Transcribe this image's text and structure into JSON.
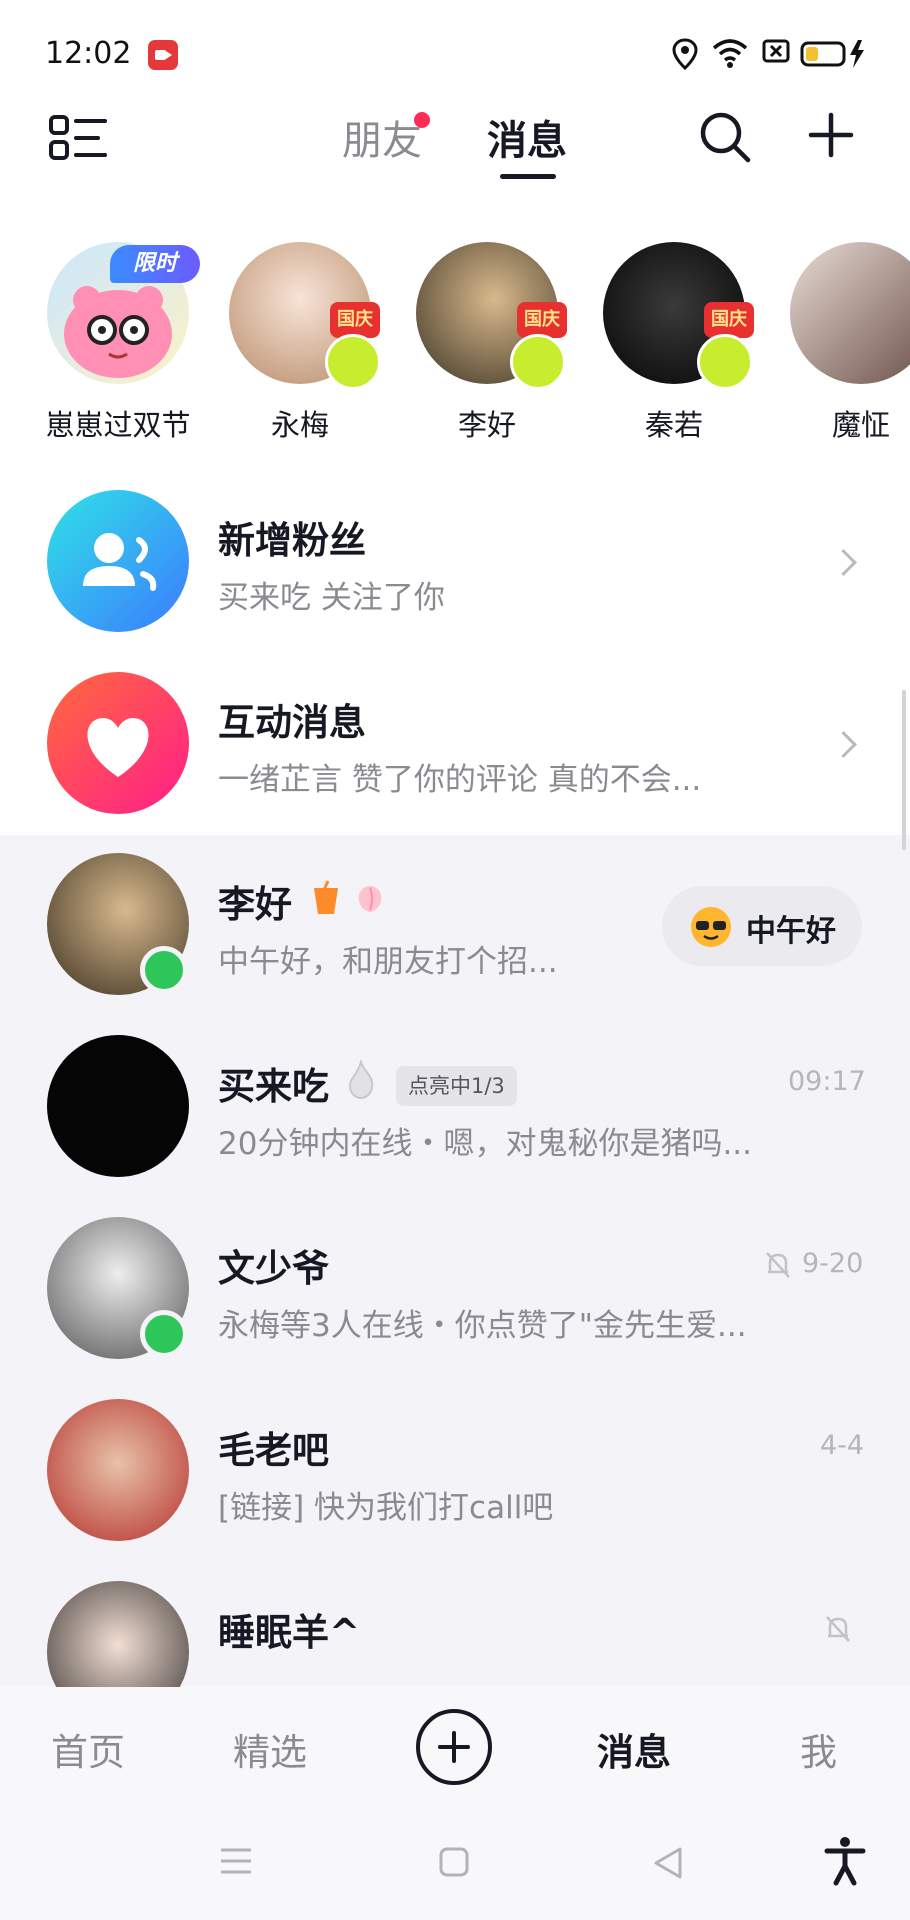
{
  "status_bar": {
    "time": "12:02"
  },
  "header": {
    "tabs": [
      {
        "label": "朋友"
      },
      {
        "label": "消息"
      }
    ]
  },
  "stories": [
    {
      "name": "崽崽过双节",
      "tag": "限时"
    },
    {
      "name": "永梅",
      "badge": "国庆"
    },
    {
      "name": "李好",
      "badge": "国庆"
    },
    {
      "name": "秦若",
      "badge": "国庆"
    },
    {
      "name": "魔怔"
    }
  ],
  "system_rows": [
    {
      "title": "新增粉丝",
      "subtitle": "买来吃 关注了你"
    },
    {
      "title": "互动消息",
      "subtitle": "一绪芷言 赞了你的评论 真的不会..."
    }
  ],
  "chats": [
    {
      "name": "李好",
      "preview": "中午好，和朋友打个招...",
      "greeting_button": "中午好"
    },
    {
      "name": "买来吃",
      "tag": "点亮中1/3",
      "time": "09:17",
      "preview": "20分钟内在线・嗯，对鬼秘你是猪吗..."
    },
    {
      "name": "文少爷",
      "time": "9-20",
      "preview": "永梅等3人在线・你点赞了\"金先生爱..."
    },
    {
      "name": "毛老吧",
      "time": "4-4",
      "preview": "[链接] 快为我们打call吧"
    },
    {
      "name": "睡眠羊^"
    }
  ],
  "bottom_nav": [
    {
      "label": "首页"
    },
    {
      "label": "精选"
    },
    {
      "label": "消息"
    },
    {
      "label": "我"
    }
  ],
  "colors": {
    "accent": "#fe2c55",
    "online": "#2ec55a",
    "text": "#161823",
    "muted": "#8a8b91"
  }
}
